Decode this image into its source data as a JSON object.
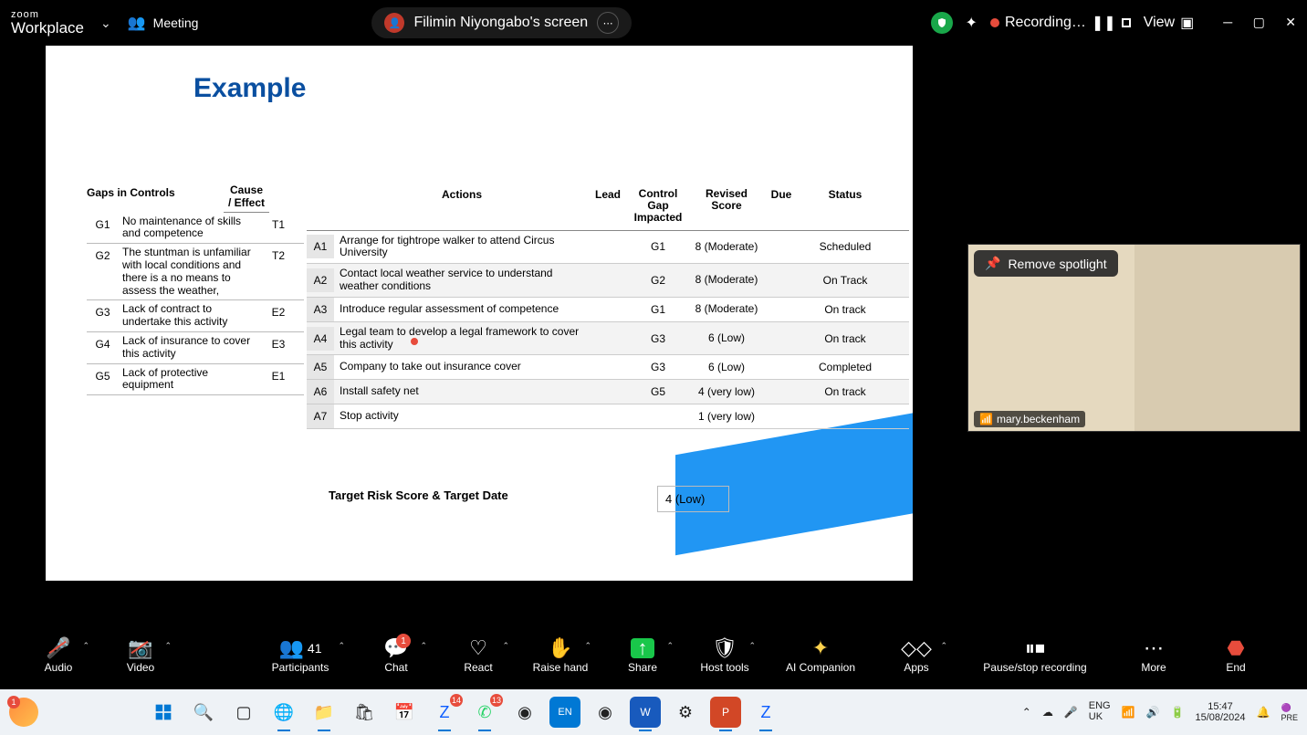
{
  "zoom_top": {
    "brand_small": "zoom",
    "brand": "Workplace",
    "meeting_label": "Meeting",
    "share_label": "Filimin Niyongabo's screen",
    "recording_label": "Recording…",
    "view_label": "View"
  },
  "slide": {
    "title": "Example",
    "gaps_header": "Gaps in Controls",
    "gaps_header2": "Cause / Effect",
    "gaps": [
      {
        "id": "G1",
        "desc": "No maintenance of skills and competence",
        "ce": "T1"
      },
      {
        "id": "G2",
        "desc": "The stuntman is unfamiliar with local conditions and there is a no means to assess the weather,",
        "ce": "T2"
      },
      {
        "id": "G3",
        "desc": "Lack of contract to undertake this activity",
        "ce": "E2"
      },
      {
        "id": "G4",
        "desc": "Lack of insurance to cover this activity",
        "ce": "E3"
      },
      {
        "id": "G5",
        "desc": "Lack of protective equipment",
        "ce": "E1"
      }
    ],
    "ahead": {
      "actions": "Actions",
      "lead": "Lead",
      "gap": "Control Gap Impacted",
      "score": "Revised Score",
      "due": "Due",
      "status": "Status"
    },
    "actions": [
      {
        "id": "A1",
        "act": "Arrange for tightrope walker to attend Circus University",
        "lead": "",
        "gap": "G1",
        "score": "8 (Moderate)",
        "due": "",
        "status": "Scheduled"
      },
      {
        "id": "A2",
        "act": "Contact local weather service to understand weather conditions",
        "lead": "",
        "gap": "G2",
        "score": "8 (Moderate)",
        "due": "",
        "status": "On Track"
      },
      {
        "id": "A3",
        "act": "Introduce regular assessment of competence",
        "lead": "",
        "gap": "G1",
        "score": "8 (Moderate)",
        "due": "",
        "status": "On track"
      },
      {
        "id": "A4",
        "act": "Legal team to develop a legal framework to cover this activity",
        "lead": "",
        "gap": "G3",
        "score": "6 (Low)",
        "due": "",
        "status": "On track"
      },
      {
        "id": "A5",
        "act": "Company to take out insurance cover",
        "lead": "",
        "gap": "G3",
        "score": "6 (Low)",
        "due": "",
        "status": "Completed"
      },
      {
        "id": "A6",
        "act": "Install safety net",
        "lead": "",
        "gap": "G5",
        "score": "4 (very low)",
        "due": "",
        "status": "On track"
      },
      {
        "id": "A7",
        "act": "Stop activity",
        "lead": "",
        "gap": "",
        "score": "1 (very low)",
        "due": "",
        "status": ""
      }
    ],
    "target_label": "Target Risk Score & Target Date",
    "target_value": "4 (Low)"
  },
  "camera": {
    "remove_spotlight": "Remove spotlight",
    "participant": "mary.beckenham"
  },
  "zoom_bot": {
    "audio": "Audio",
    "video": "Video",
    "participants": "Participants",
    "participants_count": "41",
    "chat": "Chat",
    "chat_badge": "1",
    "react": "React",
    "raise": "Raise hand",
    "share": "Share",
    "host": "Host tools",
    "ai": "AI Companion",
    "apps": "Apps",
    "pause": "Pause/stop recording",
    "more": "More",
    "end": "End"
  },
  "taskbar": {
    "lang1": "ENG",
    "lang2": "UK",
    "time": "15:47",
    "date": "15/08/2024",
    "copilot": "PRE",
    "badges": {
      "zoom": "14",
      "whatsapp": "13",
      "orange": "1"
    }
  }
}
